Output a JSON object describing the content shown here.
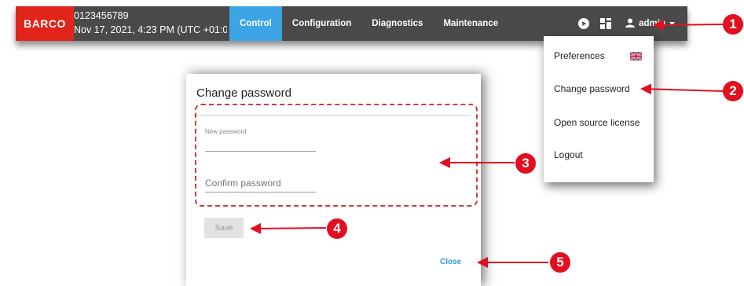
{
  "header": {
    "brand": "BARCO",
    "device_serial": "0123456789",
    "datetime": "Nov 17, 2021, 4:23 PM (UTC +01:0...",
    "nav": [
      {
        "label": "Control",
        "active": true
      },
      {
        "label": "Configuration",
        "active": false
      },
      {
        "label": "Diagnostics",
        "active": false
      },
      {
        "label": "Maintenance",
        "active": false
      }
    ],
    "icons": [
      "play-icon",
      "layout-icon",
      "user-icon",
      "caret-down-icon"
    ],
    "user": "admin"
  },
  "user_menu": {
    "items": [
      "Preferences",
      "Change password",
      "Open source license",
      "Logout"
    ],
    "flag_icon": "uk-flag-icon"
  },
  "dialog": {
    "title": "Change password",
    "new_password_label": "New password",
    "new_password_value": "",
    "confirm_password_placeholder": "Confirm password",
    "save_label": "Save",
    "close_label": "Close"
  },
  "callouts": [
    "1",
    "2",
    "3",
    "4",
    "5"
  ],
  "colors": {
    "brand_red": "#e1251b",
    "header_bg": "#4a4a4a",
    "active_tab": "#3ba5e5",
    "callout_red": "#e10f1f",
    "link_blue": "#2a9ad8"
  }
}
